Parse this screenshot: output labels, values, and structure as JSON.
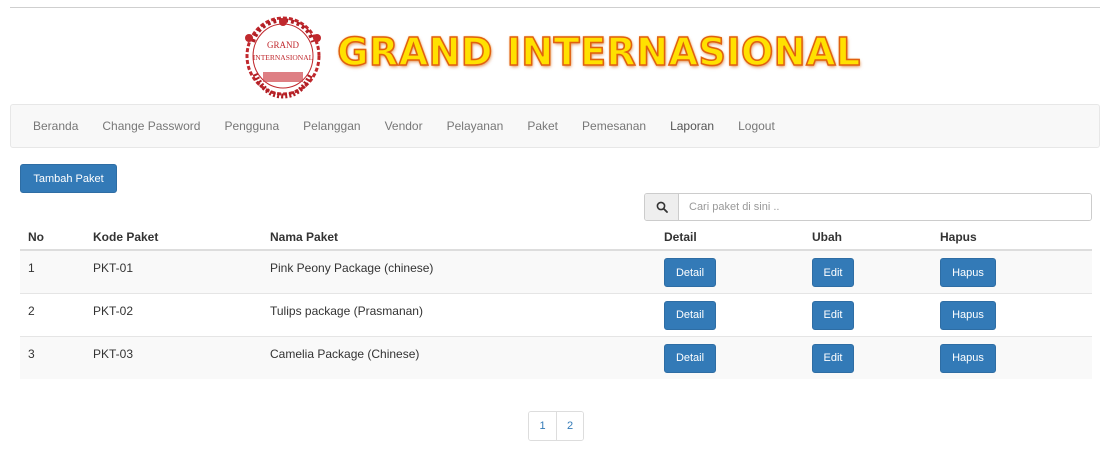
{
  "header": {
    "seal_text_line1": "GRAND",
    "seal_text_line2": "INTERNASIONAL",
    "brand_title": "GRAND INTERNASIONAL",
    "brand_color": "#ffe100",
    "brand_outline": "#e06010",
    "seal_color": "#c0282d"
  },
  "nav": {
    "items": [
      {
        "label": "Beranda"
      },
      {
        "label": "Change Password"
      },
      {
        "label": "Pengguna"
      },
      {
        "label": "Pelanggan"
      },
      {
        "label": "Vendor"
      },
      {
        "label": "Pelayanan"
      },
      {
        "label": "Paket"
      },
      {
        "label": "Pemesanan"
      },
      {
        "label": "Laporan"
      },
      {
        "label": "Logout"
      }
    ]
  },
  "toolbar": {
    "add_label": "Tambah Paket"
  },
  "search": {
    "icon": "search-icon",
    "placeholder": "Cari paket di sini .."
  },
  "table": {
    "headers": [
      "No",
      "Kode Paket",
      "Nama Paket",
      "Detail",
      "Ubah",
      "Hapus"
    ],
    "rows": [
      {
        "no": "1",
        "kode": "PKT-01",
        "nama": "Pink Peony Package (chinese)",
        "detail": "Detail",
        "edit": "Edit",
        "hapus": "Hapus"
      },
      {
        "no": "2",
        "kode": "PKT-02",
        "nama": "Tulips package (Prasmanan)",
        "detail": "Detail",
        "edit": "Edit",
        "hapus": "Hapus"
      },
      {
        "no": "3",
        "kode": "PKT-03",
        "nama": "Camelia Package (Chinese)",
        "detail": "Detail",
        "edit": "Edit",
        "hapus": "Hapus"
      }
    ]
  },
  "pagination": {
    "pages": [
      "1",
      "2"
    ]
  },
  "colors": {
    "primary": "#337ab7",
    "navbar_bg": "#f8f8f8"
  }
}
